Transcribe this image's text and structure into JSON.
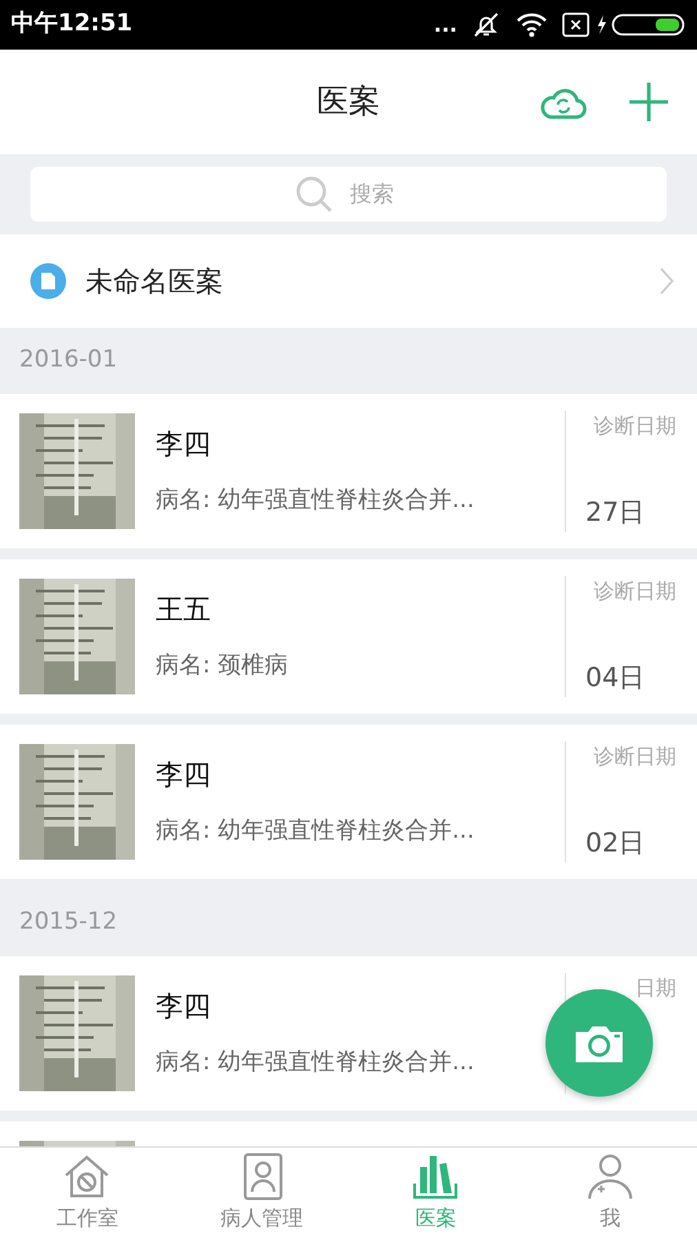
{
  "status_bar": {
    "time": "中午12:51",
    "dots": "..."
  },
  "header": {
    "title": "医案"
  },
  "search": {
    "placeholder": "搜索"
  },
  "unnamed": {
    "label": "未命名医案"
  },
  "groups": [
    {
      "month": "2016-01",
      "records": [
        {
          "name": "李四",
          "diagnosis": "病名: 幼年强直性脊柱炎合并...",
          "date_label": "诊断日期",
          "date": "27日"
        },
        {
          "name": "王五",
          "diagnosis": "病名: 颈椎病",
          "date_label": "诊断日期",
          "date": "04日"
        },
        {
          "name": "李四",
          "diagnosis": "病名: 幼年强直性脊柱炎合并...",
          "date_label": "诊断日期",
          "date": "02日"
        }
      ]
    },
    {
      "month": "2015-12",
      "records": [
        {
          "name": "李四",
          "diagnosis": "病名: 幼年强直性脊柱炎合并...",
          "date_label": "日期"
        },
        {
          "kind": "picture"
        }
      ]
    }
  ],
  "tabs": [
    {
      "label": "工作室",
      "selected": false
    },
    {
      "label": "病人管理",
      "selected": false
    },
    {
      "label": "医案",
      "selected": true
    },
    {
      "label": "我",
      "selected": false
    }
  ]
}
